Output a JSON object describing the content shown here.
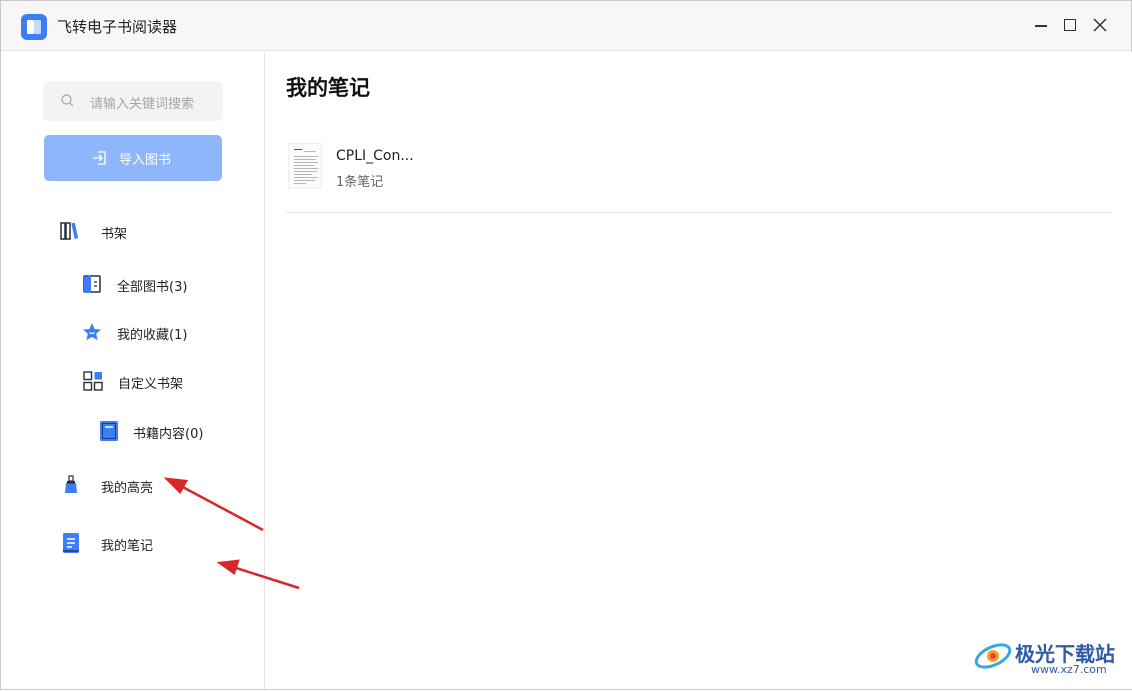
{
  "window": {
    "title": "飞转电子书阅读器",
    "icons": {
      "logo": "app-logo-icon",
      "minimize": "minimize-icon",
      "maximize": "maximize-icon",
      "close": "close-icon"
    }
  },
  "sidebar": {
    "search": {
      "placeholder": "请输入关键词搜索",
      "icon": "search-icon"
    },
    "import_button": {
      "label": "导入图书",
      "icon": "import-icon"
    },
    "items": [
      {
        "label": "书架",
        "icon": "bookshelf-icon"
      },
      {
        "label": "全部图书(3)",
        "icon": "book-icon"
      },
      {
        "label": "我的收藏(1)",
        "icon": "star-icon"
      },
      {
        "label": "自定义书架",
        "icon": "grid-icon"
      },
      {
        "label": "书籍内容(0)",
        "icon": "notebook-icon"
      },
      {
        "label": "我的高亮",
        "icon": "highlighter-icon"
      },
      {
        "label": "我的笔记",
        "icon": "note-icon"
      }
    ]
  },
  "main": {
    "title": "我的笔记",
    "notes": [
      {
        "book_name": "CPLI_Con...",
        "count": "1条笔记"
      }
    ]
  },
  "watermark": {
    "text": "极光下载站",
    "url": "www.xz7.com"
  },
  "colors": {
    "accent": "#3d7ef5",
    "import_button": "#8fb5fa",
    "annotation_arrow": "#d9262b"
  }
}
